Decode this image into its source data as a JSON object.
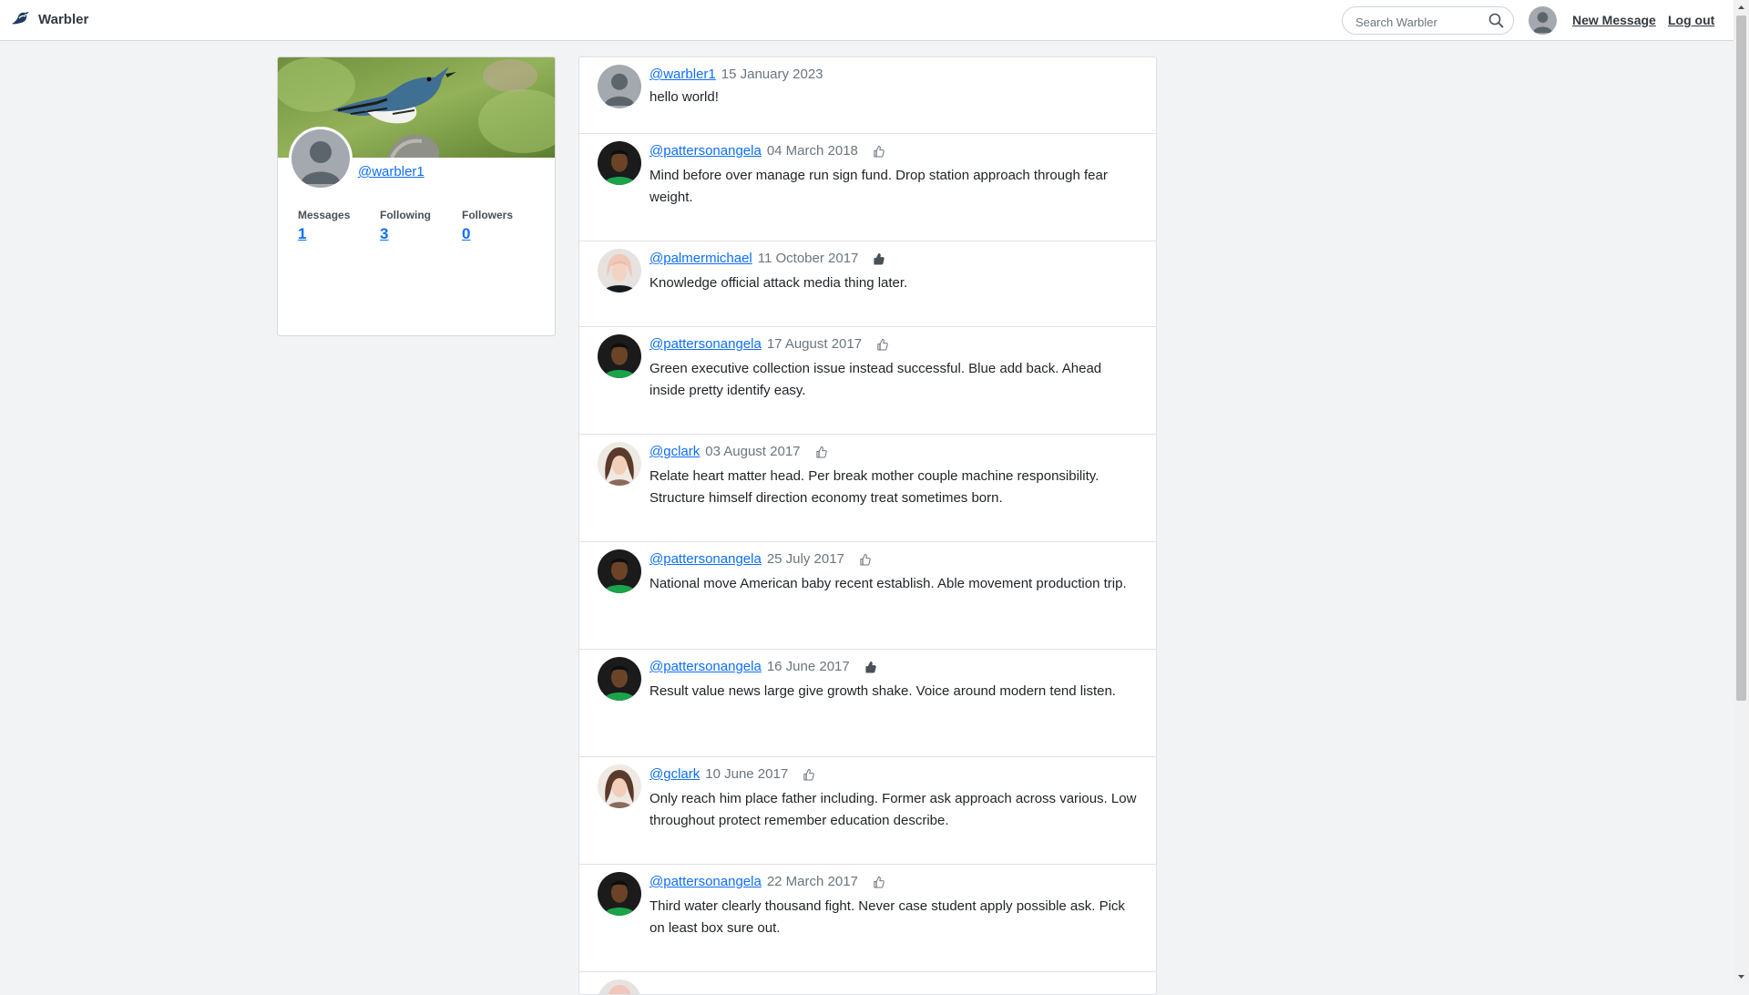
{
  "navbar": {
    "brand": "Warbler",
    "search_placeholder": "Search Warbler",
    "new_message": "New Message",
    "logout": "Log out"
  },
  "profile": {
    "handle": "@warbler1",
    "stats": {
      "messages_label": "Messages",
      "messages": "1",
      "following_label": "Following",
      "following": "3",
      "followers_label": "Followers",
      "followers": "0"
    }
  },
  "messages": [
    {
      "user": "@warbler1",
      "date": "15 January 2023",
      "text": "hello world!",
      "avatar": "default-avatar",
      "like": "none"
    },
    {
      "user": "@pattersonangela",
      "date": "04 March 2018",
      "text": "Mind before over manage run sign fund. Drop station approach through fear weight.",
      "avatar": "man-green-shirt",
      "like": "outline"
    },
    {
      "user": "@palmermichael",
      "date": "11 October 2017",
      "text": "Knowledge official attack media thing later.",
      "avatar": "woman-blonde",
      "like": "filled"
    },
    {
      "user": "@pattersonangela",
      "date": "17 August 2017",
      "text": "Green executive collection issue instead successful. Blue add back. Ahead inside pretty identify easy.",
      "avatar": "man-green-shirt",
      "like": "outline"
    },
    {
      "user": "@gclark",
      "date": "03 August 2017",
      "text": "Relate heart matter head. Per break mother couple machine responsibility. Structure himself direction economy treat sometimes born.",
      "avatar": "woman-brunette",
      "like": "outline"
    },
    {
      "user": "@pattersonangela",
      "date": "25 July 2017",
      "text": "National move American baby recent establish. Able movement production trip.",
      "avatar": "man-green-shirt",
      "like": "outline"
    },
    {
      "user": "@pattersonangela",
      "date": "16 June 2017",
      "text": "Result value news large give growth shake. Voice around modern tend listen.",
      "avatar": "man-green-shirt",
      "like": "filled"
    },
    {
      "user": "@gclark",
      "date": "10 June 2017",
      "text": "Only reach him place father including. Former ask approach across various. Low throughout protect remember education describe.",
      "avatar": "woman-brunette",
      "like": "outline"
    },
    {
      "user": "@pattersonangela",
      "date": "22 March 2017",
      "text": "Third water clearly thousand fight. Never case student apply possible ask. Pick on least box sure out.",
      "avatar": "man-green-shirt",
      "like": "outline"
    }
  ],
  "colors": {
    "link": "#0d6efd",
    "page_bg": "#f1f3f4",
    "border": "#dee2e6",
    "muted": "#6c757d"
  }
}
